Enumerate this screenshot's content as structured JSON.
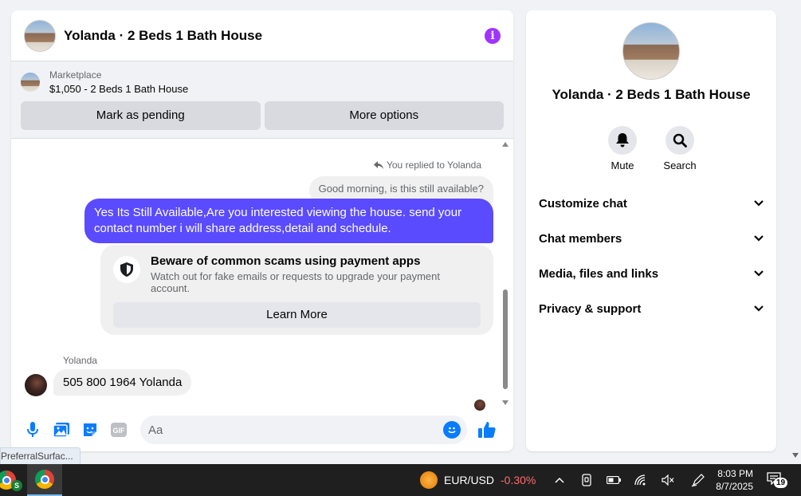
{
  "chat": {
    "title": "Yolanda · 2 Beds 1 Bath House",
    "info_icon": "info-icon",
    "marketplace": {
      "label": "Marketplace",
      "listing": "$1,050 - 2 Beds 1 Bath House",
      "mark_pending": "Mark as pending",
      "more_options": "More options"
    },
    "messages": {
      "replied_note": "You replied to Yolanda",
      "quoted": "Good morning, is this still available?",
      "outgoing": "Yes Its Still Available,Are you interested viewing the house. send your contact number i will share address,detail and schedule.",
      "scam_title": "Beware of common scams using payment apps",
      "scam_sub": "Watch out for fake emails or requests to upgrade your payment account.",
      "learn_more": "Learn More",
      "sender_name": "Yolanda",
      "incoming": "505 800 1964 Yolanda"
    },
    "composer": {
      "placeholder": "Aa",
      "icons": [
        "microphone-icon",
        "photo-icon",
        "sticker-icon",
        "gif-icon",
        "emoji-icon",
        "like-icon"
      ],
      "gif_label": "GIF"
    },
    "accent_color": "#5b4bff"
  },
  "info": {
    "title": "Yolanda · 2 Beds 1 Bath House",
    "mute_label": "Mute",
    "search_label": "Search",
    "sections": [
      "Customize chat",
      "Chat members",
      "Media, files and links",
      "Privacy & support"
    ]
  },
  "tooltip": "PreferralSurfac...",
  "taskbar": {
    "pair": "EUR/USD",
    "change": "-0.30%",
    "time": "8:03 PM",
    "date": "8/7/2025",
    "notifications": "19",
    "app1_badge": "S"
  }
}
